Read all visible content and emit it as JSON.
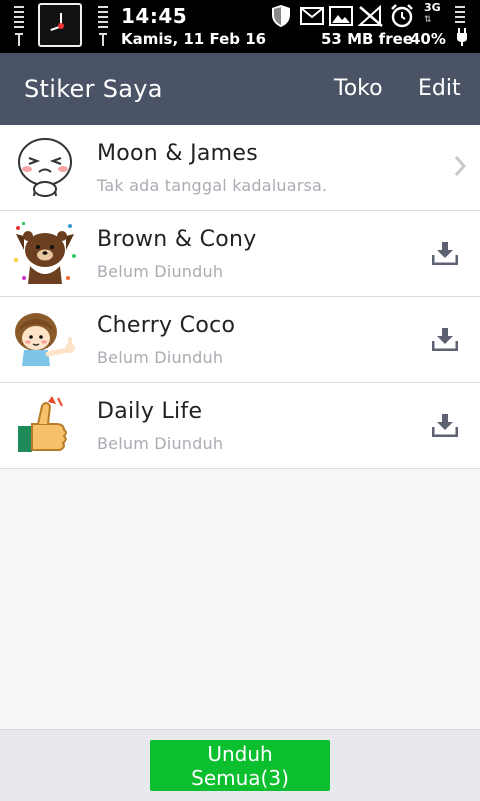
{
  "status_bar": {
    "time": "14:45",
    "date": "Kamis, 11 Feb 16",
    "storage_free": "53 MB free",
    "battery": "40%",
    "network": "3G",
    "icons": [
      "signal-icon",
      "clock-widget-icon",
      "shield-icon",
      "mail-icon",
      "image-icon",
      "no-signal-icon",
      "alarm-icon",
      "charging-icon"
    ]
  },
  "header": {
    "title": "Stiker Saya",
    "shop_label": "Toko",
    "edit_label": "Edit",
    "background": "#4b5466"
  },
  "stickers": [
    {
      "name": "Moon & James",
      "status": "Tak ada tanggal kadaluarsa.",
      "action": "chevron-right-icon"
    },
    {
      "name": "Brown & Cony",
      "status": "Belum Diunduh",
      "action": "download-icon"
    },
    {
      "name": "Cherry Coco",
      "status": "Belum Diunduh",
      "action": "download-icon"
    },
    {
      "name": "Daily Life",
      "status": "Belum Diunduh",
      "action": "download-icon"
    }
  ],
  "footer": {
    "download_all_label": "Unduh Semua(3)",
    "button_color": "#0cbf2e"
  }
}
